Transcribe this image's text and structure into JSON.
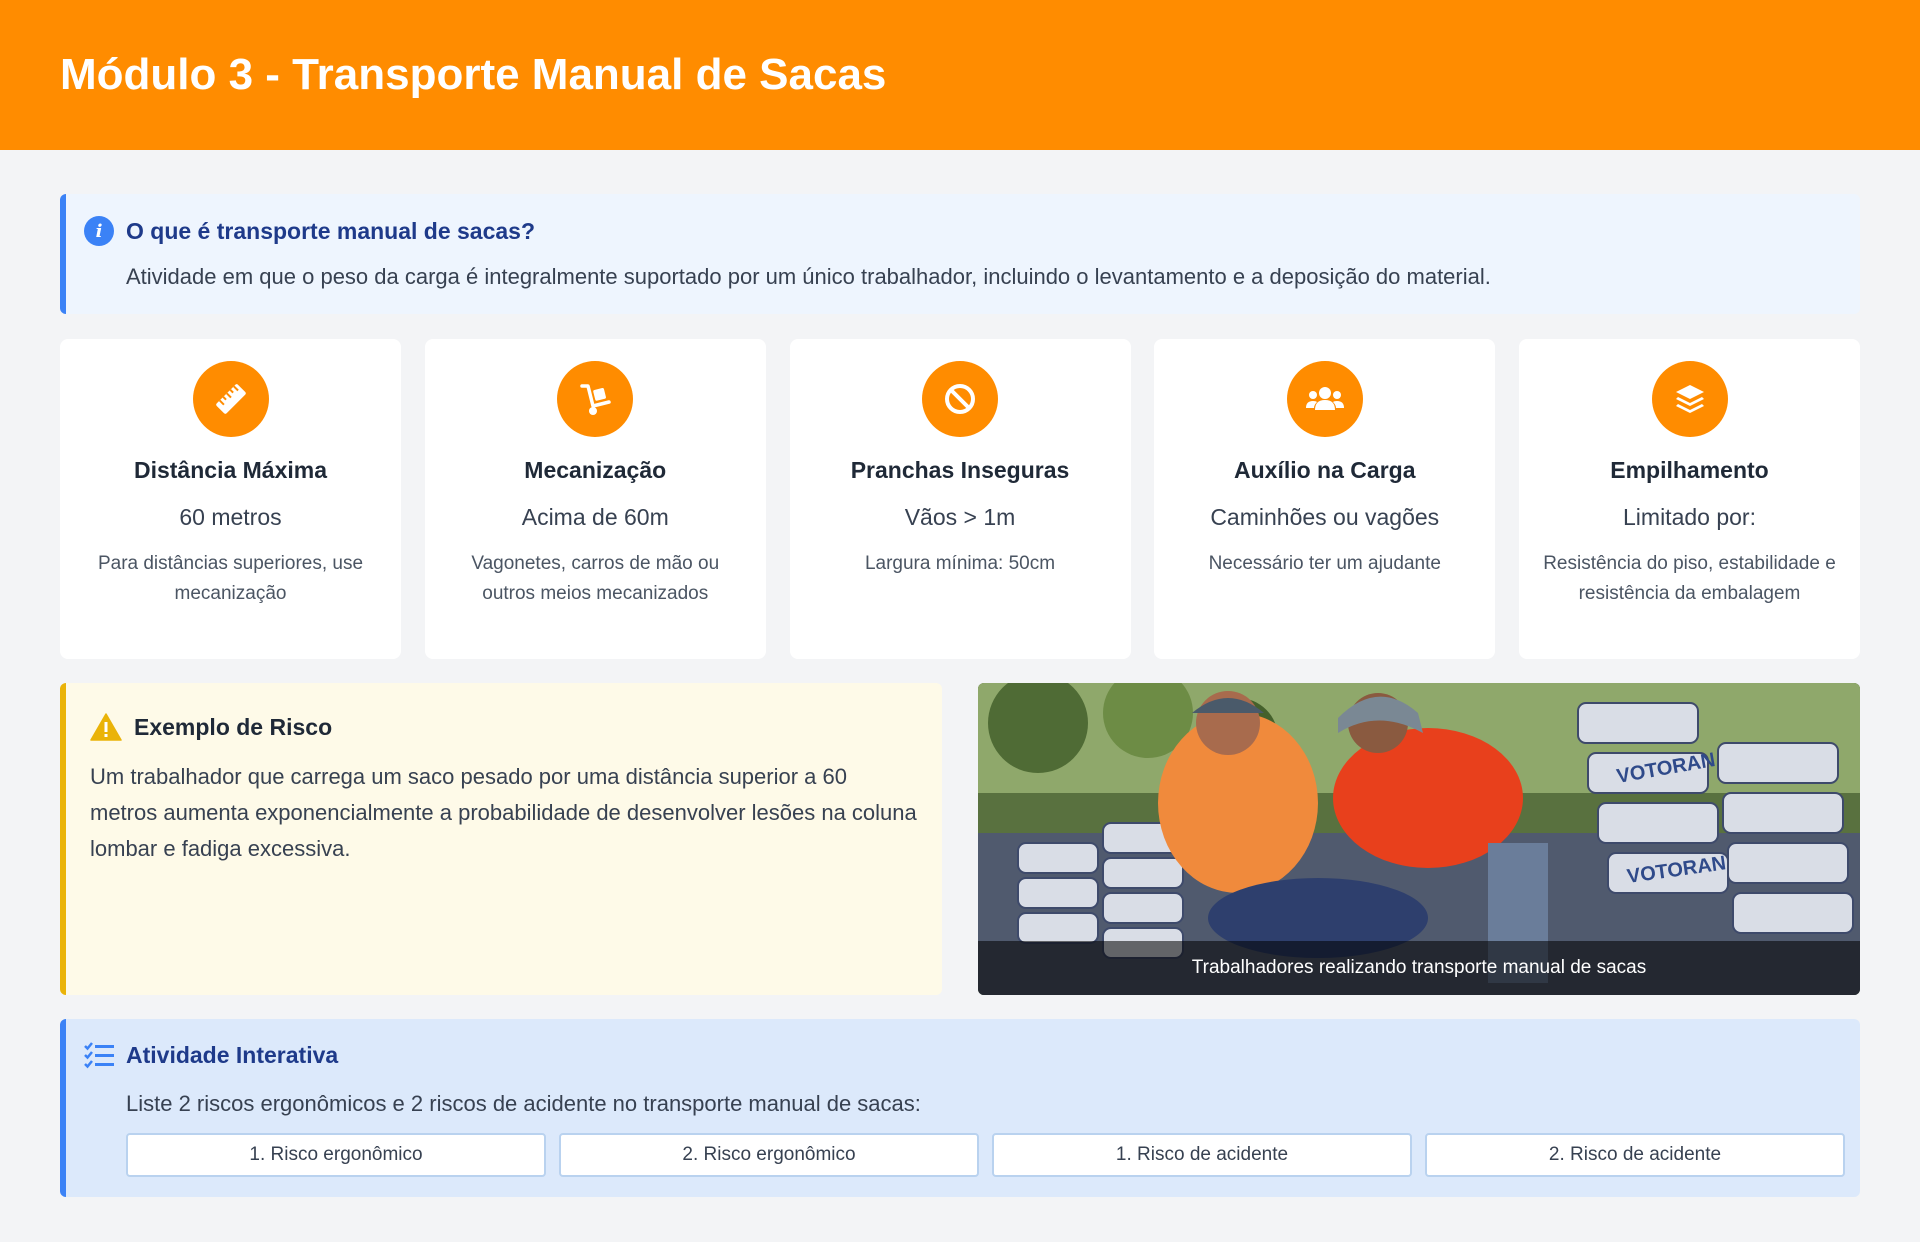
{
  "header": {
    "title": "Módulo 3 - Transporte Manual de Sacas",
    "color": "#ff8c00"
  },
  "info": {
    "icon": "info-icon",
    "title": "O que é transporte manual de sacas?",
    "text": "Atividade em que o peso da carga é integralmente suportado por um único trabalhador, incluindo o levantamento e a deposição do material."
  },
  "cards": [
    {
      "icon": "ruler-icon",
      "title": "Distância Máxima",
      "value": "60 metros",
      "desc": "Para distâncias superiores, use mecanização"
    },
    {
      "icon": "hand-truck-icon",
      "title": "Mecanização",
      "value": "Acima de 60m",
      "desc": "Vagonetes, carros de mão ou outros meios mecanizados"
    },
    {
      "icon": "ban-icon",
      "title": "Pranchas Inseguras",
      "value": "Vãos > 1m",
      "desc": "Largura mínima: 50cm"
    },
    {
      "icon": "users-icon",
      "title": "Auxílio na Carga",
      "value": "Caminhões ou vagões",
      "desc": "Necessário ter um ajudante"
    },
    {
      "icon": "layers-icon",
      "title": "Empilhamento",
      "value": "Limitado por:",
      "desc": "Resistência do piso, estabilidade e resistência da embalagem"
    }
  ],
  "risk": {
    "icon": "warning-icon",
    "title": "Exemplo de Risco",
    "text": "Um trabalhador que carrega um saco pesado por uma distância superior a 60 metros aumenta exponencialmente a probabilidade de desenvolver lesões na coluna lombar e fadiga excessiva."
  },
  "photo": {
    "caption": "Trabalhadores realizando transporte manual de sacas"
  },
  "activity": {
    "icon": "task-list-icon",
    "title": "Atividade Interativa",
    "text": "Liste 2 riscos ergonômicos e 2 riscos de acidente no transporte manual de sacas:",
    "inputs": [
      {
        "placeholder": "1. Risco ergonômico"
      },
      {
        "placeholder": "2. Risco ergonômico"
      },
      {
        "placeholder": "1. Risco de acidente"
      },
      {
        "placeholder": "2. Risco de acidente"
      }
    ]
  }
}
